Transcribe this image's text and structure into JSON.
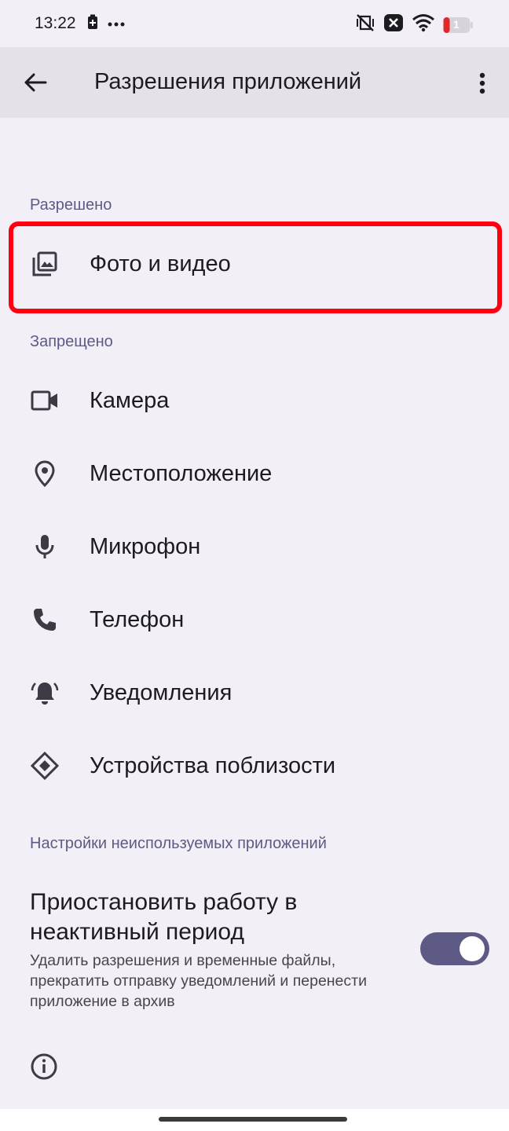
{
  "status_bar": {
    "time": "13:22",
    "battery_level": "1",
    "icons": [
      "battery-saver-icon",
      "more-dots-icon",
      "vibrate-off-icon",
      "sim-x-icon",
      "wifi-icon",
      "battery-icon"
    ]
  },
  "app_bar": {
    "title": "Разрешения приложений",
    "back_icon": "arrow-back-icon",
    "menu_icon": "more-vert-icon"
  },
  "sections": {
    "allowed": {
      "header": "Разрешено",
      "items": [
        {
          "label": "Фото и видео",
          "icon": "photo-library-icon"
        }
      ]
    },
    "denied": {
      "header": "Запрещено",
      "items": [
        {
          "label": "Камера",
          "icon": "videocam-icon"
        },
        {
          "label": "Местоположение",
          "icon": "location-pin-icon"
        },
        {
          "label": "Микрофон",
          "icon": "mic-icon"
        },
        {
          "label": "Телефон",
          "icon": "phone-icon"
        },
        {
          "label": "Уведомления",
          "icon": "bell-icon"
        },
        {
          "label": "Устройства поблизости",
          "icon": "nearby-devices-icon"
        }
      ]
    },
    "unused": {
      "header": "Настройки неиспользуемых приложений",
      "setting_title": "Приостановить работу в неактивный период",
      "setting_desc": "Удалить разрешения и временные файлы, прекратить отправку уведомлений и перенести приложение в архив",
      "toggle_on": true
    }
  },
  "colors": {
    "background": "#f3eff6",
    "app_bar": "#e6e1e8",
    "accent": "#5e5a86",
    "highlight": "#ff0010"
  }
}
